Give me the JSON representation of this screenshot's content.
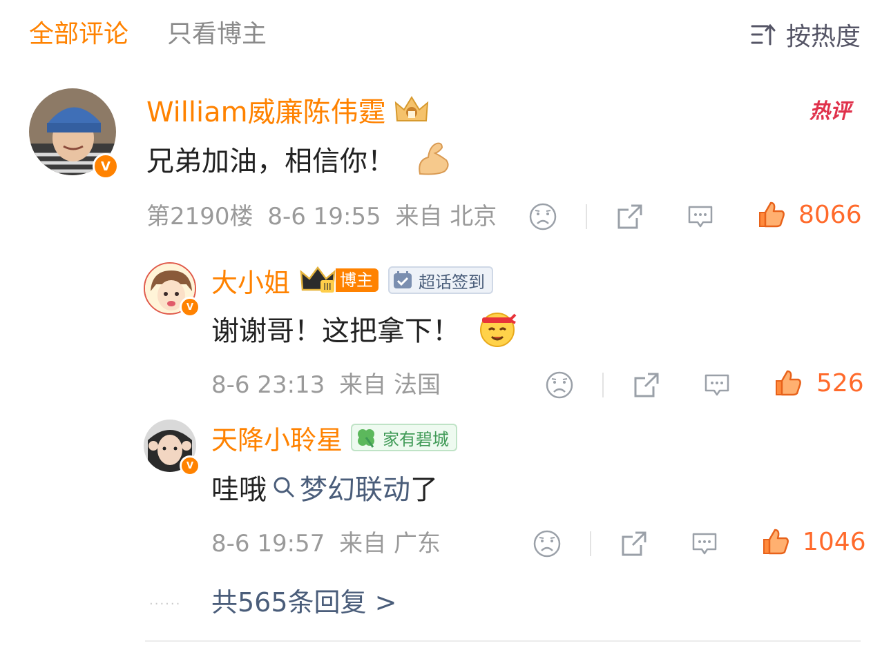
{
  "tabs": {
    "all": "全部评论",
    "host_only": "只看博主"
  },
  "sort": {
    "label": "按热度",
    "icon": "sort-icon"
  },
  "comment": {
    "username": "William威廉陈伟霆",
    "text": "兄弟加油，相信你！",
    "hot_badge": "热评",
    "floor": "第2190楼",
    "datetime": "8-6 19:55",
    "source": "来自 北京",
    "likes": "8066"
  },
  "replies": [
    {
      "username": "大小姐",
      "host_tag": "博主",
      "topic_tag": "超话签到",
      "text": "谢谢哥！这把拿下！",
      "datetime": "8-6 23:13",
      "source": "来自 法国",
      "likes": "526"
    },
    {
      "username": "天降小聆星",
      "fan_tag": "家有碧城",
      "text_prefix": "哇哦",
      "link_text": "梦幻联动",
      "text_suffix": "了",
      "datetime": "8-6 19:57",
      "source": "来自 广东",
      "likes": "1046"
    }
  ],
  "more": {
    "dots": "......",
    "label": "共565条回复 >"
  },
  "colors": {
    "accent": "#ff8200",
    "like": "#ff6a2b",
    "link": "#4a5d7a",
    "muted": "#9a9a9a"
  }
}
